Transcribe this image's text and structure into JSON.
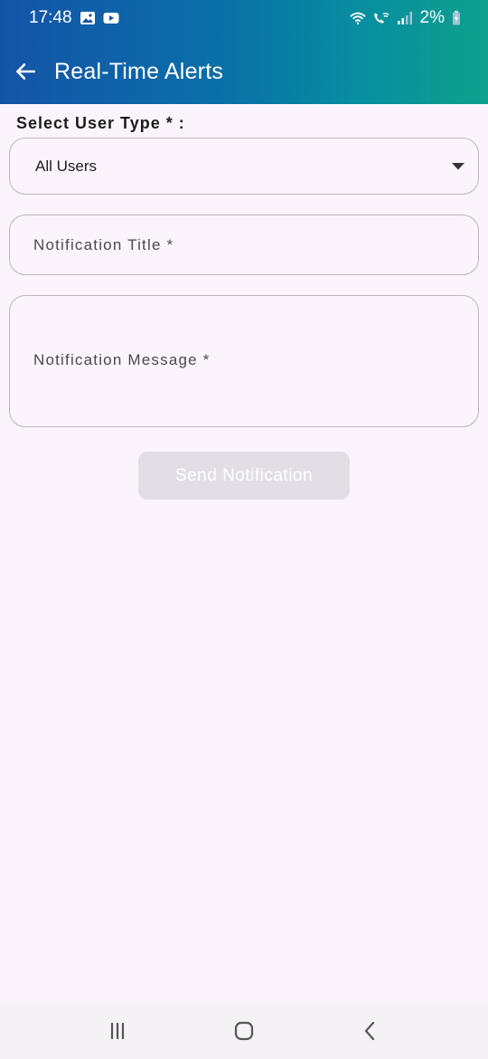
{
  "status_bar": {
    "time": "17:48",
    "battery": "2%",
    "icons": [
      "gallery-icon",
      "youtube-icon",
      "wifi-icon",
      "wifi-calling-icon",
      "signal-icon",
      "battery-charging-icon"
    ]
  },
  "appbar": {
    "title": "Real-Time Alerts",
    "back_icon": "arrow-back-icon"
  },
  "form": {
    "user_type_label": "Select User Type * :",
    "user_type_value": "All Users",
    "title_placeholder": "Notification Title *",
    "message_placeholder": "Notification Message *",
    "send_label": "Send Notification"
  },
  "nav_bar": {
    "icons": [
      "recent-apps-icon",
      "home-icon",
      "back-icon"
    ]
  },
  "colors": {
    "header_start": "#1454A8",
    "header_end": "#0FA08C",
    "background": "#FCF4FC",
    "button_disabled": "#E3DEE5"
  }
}
